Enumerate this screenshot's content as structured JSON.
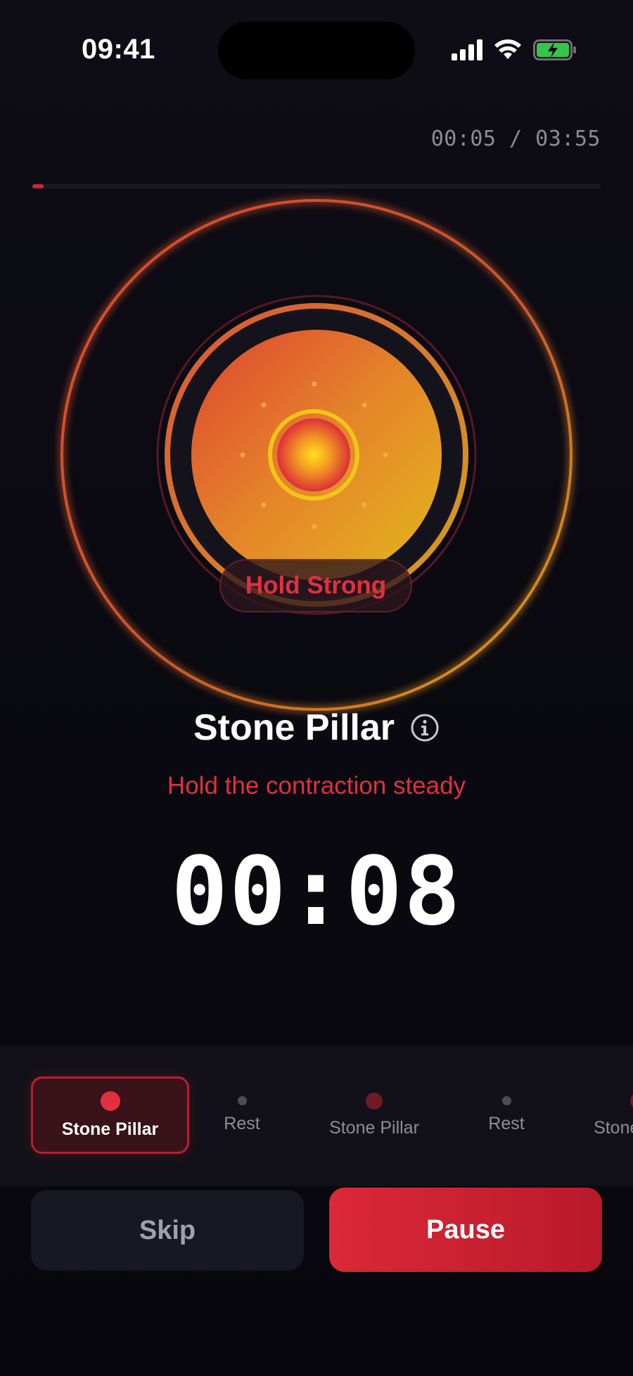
{
  "status_bar": {
    "time": "09:41",
    "icons": [
      "cellular-signal-icon",
      "wifi-icon",
      "battery-charging-icon"
    ]
  },
  "session": {
    "elapsed": "00:05 / 03:55",
    "progress": 0.02
  },
  "phase": {
    "label": "Hold Strong"
  },
  "exercise": {
    "name": "Stone Pillar",
    "instruction": "Hold the contraction steady",
    "countdown": "00:08"
  },
  "steps": [
    {
      "label": "Stone Pillar",
      "active": true
    },
    {
      "label": "Rest",
      "active": false
    },
    {
      "label": "Stone Pillar",
      "active": false
    },
    {
      "label": "Rest",
      "active": false
    },
    {
      "label": "Stone Pillar",
      "active": false
    }
  ],
  "actions": {
    "skip_label": "Skip",
    "pause_label": "Pause"
  },
  "colors": {
    "accent_red": "#e0303f",
    "orb_orange": "#e8742a",
    "orb_yellow": "#e8b21c",
    "background": "#0b0a12"
  }
}
